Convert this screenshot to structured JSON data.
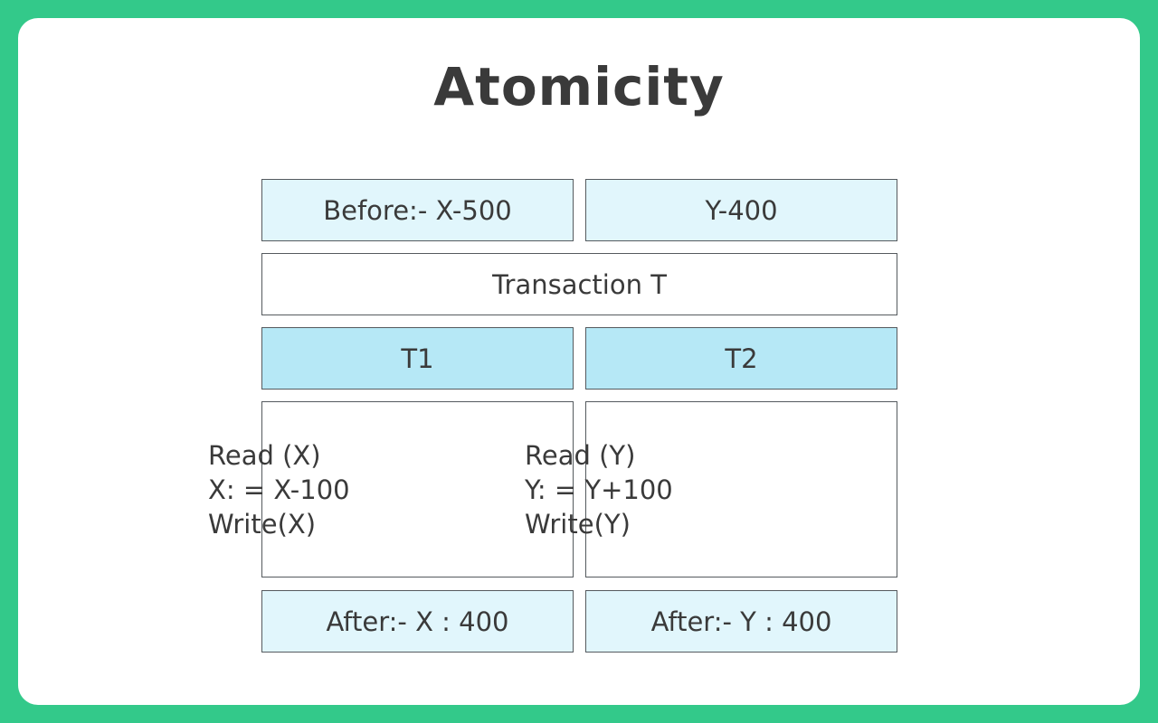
{
  "title": "Atomicity",
  "before": {
    "x": "Before:- X-500",
    "y": "Y-400"
  },
  "transaction": "Transaction T",
  "t1": {
    "label": "T1",
    "steps": [
      "Read (X)",
      "X: = X-100",
      "Write(X)"
    ]
  },
  "t2": {
    "label": "T2",
    "steps": [
      "Read (Y)",
      "Y: = Y+100",
      "Write(Y)"
    ]
  },
  "after": {
    "x": "After:- X : 400",
    "y": "After:- Y : 400"
  },
  "colors": {
    "frame": "#33c98a",
    "light_cell": "#e1f6fc",
    "header_cell": "#b6e8f6",
    "text": "#3a3a3a"
  }
}
